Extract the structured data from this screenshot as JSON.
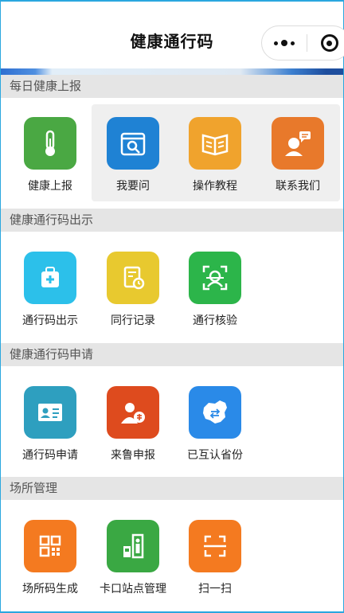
{
  "nav": {
    "title": "健康通行码"
  },
  "sections": [
    {
      "title": "每日健康上报"
    },
    {
      "title": "健康通行码出示"
    },
    {
      "title": "健康通行码申请"
    },
    {
      "title": "场所管理"
    }
  ],
  "tiles": {
    "health_report": {
      "label": "健康上报",
      "icon": "thermometer-icon",
      "color": "#4aa843"
    },
    "ask": {
      "label": "我要问",
      "icon": "question-search-icon",
      "color": "#1f82d4"
    },
    "tutorial": {
      "label": "操作教程",
      "icon": "book-icon",
      "color": "#f0a32d"
    },
    "contact": {
      "label": "联系我们",
      "icon": "support-agent-icon",
      "color": "#e8792b"
    },
    "show_code": {
      "label": "通行码出示",
      "icon": "medical-bag-icon",
      "color": "#2cc0ea"
    },
    "travel_record": {
      "label": "同行记录",
      "icon": "record-clock-icon",
      "color": "#e8c92f"
    },
    "verify": {
      "label": "通行核验",
      "icon": "face-scan-icon",
      "color": "#2cb54a"
    },
    "apply_code": {
      "label": "通行码申请",
      "icon": "id-card-icon",
      "color": "#2e9fbf"
    },
    "arrival_report": {
      "label": "来鲁申报",
      "icon": "person-report-icon",
      "color": "#de4b1e"
    },
    "mutual_provinces": {
      "label": "已互认省份",
      "icon": "china-map-icon",
      "color": "#2a8ae8"
    },
    "venue_code": {
      "label": "场所码生成",
      "icon": "qr-code-icon",
      "color": "#f47a20"
    },
    "checkpoint": {
      "label": "卡口站点管理",
      "icon": "checkpoint-icon",
      "color": "#3aa843"
    },
    "scan": {
      "label": "扫一扫",
      "icon": "scan-icon",
      "color": "#f47a20"
    }
  }
}
